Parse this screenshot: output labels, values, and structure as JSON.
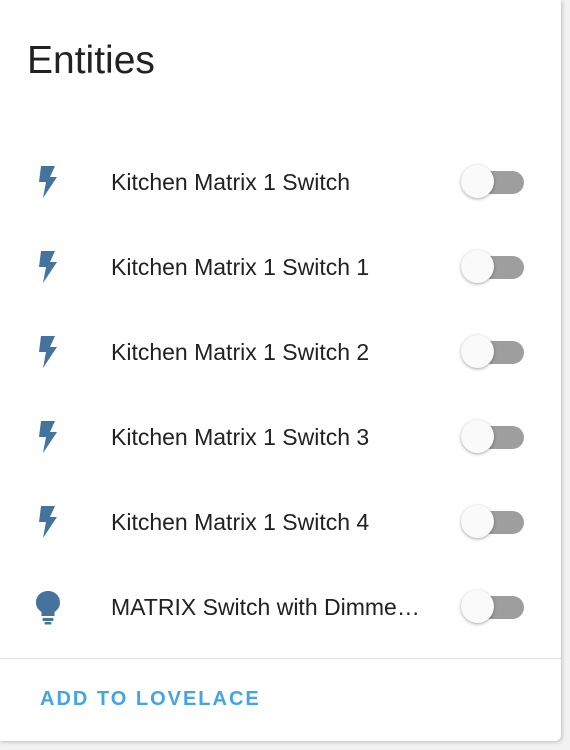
{
  "card": {
    "title": "Entities",
    "entities": [
      {
        "name": "Kitchen Matrix 1 Switch",
        "icon": "flash-icon",
        "state": "off"
      },
      {
        "name": "Kitchen Matrix 1 Switch 1",
        "icon": "flash-icon",
        "state": "off"
      },
      {
        "name": "Kitchen Matrix 1 Switch 2",
        "icon": "flash-icon",
        "state": "off"
      },
      {
        "name": "Kitchen Matrix 1 Switch 3",
        "icon": "flash-icon",
        "state": "off"
      },
      {
        "name": "Kitchen Matrix 1 Switch 4",
        "icon": "flash-icon",
        "state": "off"
      },
      {
        "name": "MATRIX Switch with Dimme…",
        "icon": "lightbulb-icon",
        "state": "off"
      }
    ],
    "action_label": "ADD TO LOVELACE"
  },
  "colors": {
    "icon": "#44739e",
    "toggle_track": "#9e9e9e",
    "toggle_thumb": "#fafafa",
    "action": "#43a4e6",
    "text": "#212121"
  }
}
